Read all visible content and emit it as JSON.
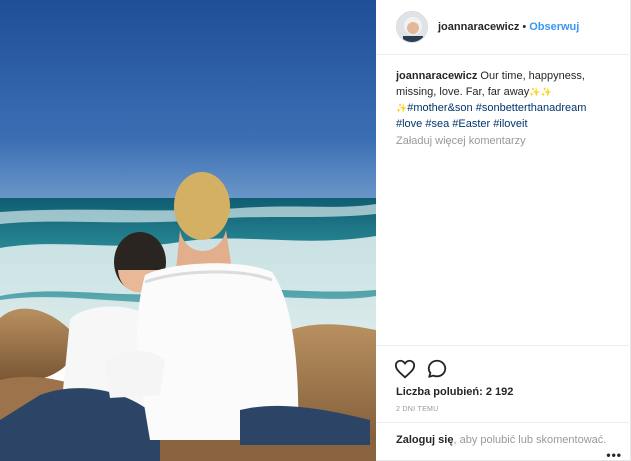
{
  "post": {
    "username": "joannaracewicz",
    "separator": "•",
    "follow_label": "Obserwuj",
    "caption": {
      "user": "joannaracewicz",
      "text": "Our time, happyness, missing, love. Far, far away",
      "sparkles": "✨✨",
      "line2_prefix": "✨",
      "tags_line2": [
        "#mother&son",
        "#sonbetterthanadream"
      ],
      "tags_line3": [
        "#love",
        "#sea",
        "#Easter",
        "#iloveit"
      ]
    },
    "load_more_comments": "Załaduj więcej komentarzy",
    "likes_label": "Liczba polubień: 2 192",
    "time_ago": "2 DNI TEMU",
    "login_link": "Zaloguj się",
    "login_text": ", aby polubić lub skomentować.",
    "more_options": "•••"
  },
  "icons": {
    "avatar": "avatar-icon",
    "like": "heart-icon",
    "comment": "comment-bubble-icon",
    "more": "more-dots-icon"
  },
  "colors": {
    "link_blue": "#3897f0",
    "hashtag": "#003569",
    "muted": "#999999",
    "text": "#262626"
  }
}
